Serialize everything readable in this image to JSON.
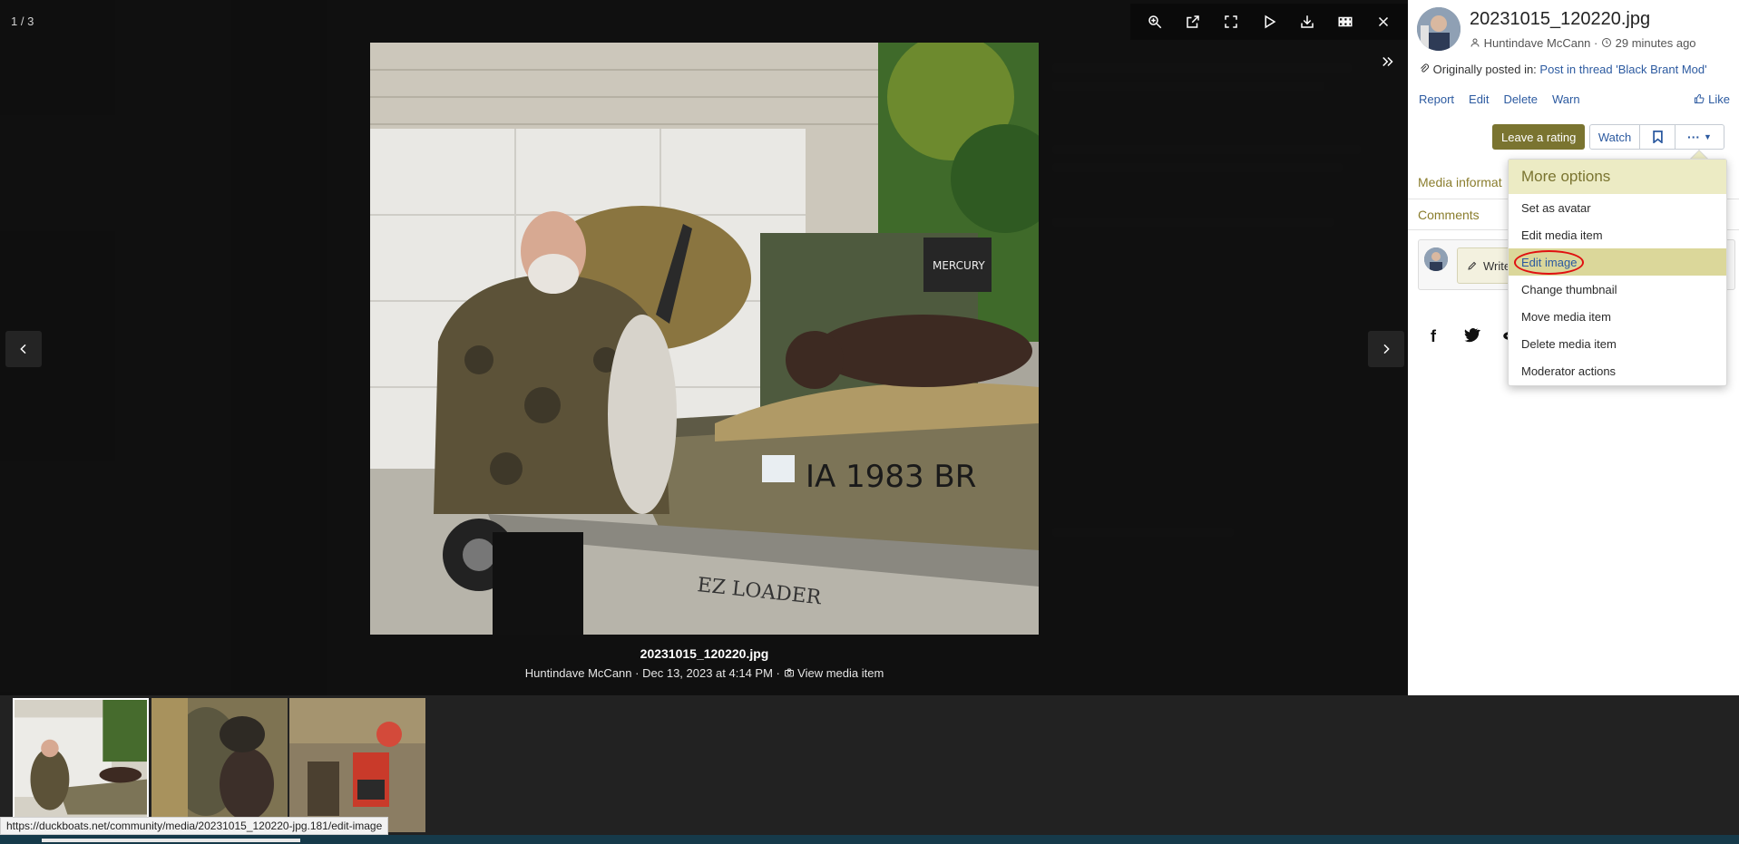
{
  "lightbox": {
    "counter": "1 / 3",
    "caption_title": "20231015_120220.jpg",
    "caption_author": "Huntindave McCann",
    "caption_date": "Dec 13, 2023 at 4:14 PM",
    "caption_link": "View media item",
    "caption_sep": "·",
    "toolbar_icons": [
      "zoom-in-icon",
      "open-new-window-icon",
      "fullscreen-icon",
      "slideshow-play-icon",
      "download-icon",
      "thumbnails-grid-icon",
      "close-icon"
    ],
    "photo_text": {
      "plate": "IA 1983 BR",
      "trailer": "EZ LOADER",
      "motor": "MERCURY"
    }
  },
  "status_url": "https://duckboats.net/community/media/20231015_120220-jpg.181/edit-image",
  "sidebar": {
    "title": "20231015_120220.jpg",
    "author": "Huntindave McCann",
    "time_ago": "29 minutes ago",
    "meta_sep": "·",
    "posted_label": "Originally posted in:",
    "posted_link": "Post in thread 'Black Brant Mod'",
    "actions": [
      "Report",
      "Edit",
      "Delete",
      "Warn"
    ],
    "like_label": "Like",
    "rating_button": "Leave a rating",
    "watch_button": "Watch",
    "more_button": "···",
    "tab_media": "Media informat",
    "tab_comments": "Comments",
    "comment_placeholder": "Write",
    "share_icons": [
      "facebook-icon",
      "twitter-icon",
      "reddit-icon"
    ]
  },
  "menu": {
    "header": "More options",
    "items": [
      "Set as avatar",
      "Edit media item",
      "Edit image",
      "Change thumbnail",
      "Move media item",
      "Delete media item",
      "Moderator actions"
    ],
    "highlighted_index": 2
  },
  "colors": {
    "accent": "#7a7430",
    "link": "#2c5aa0",
    "menu_header_bg": "#ecebc4",
    "menu_highlight_bg": "#dbd79a",
    "annotation_circle": "#e01010"
  }
}
